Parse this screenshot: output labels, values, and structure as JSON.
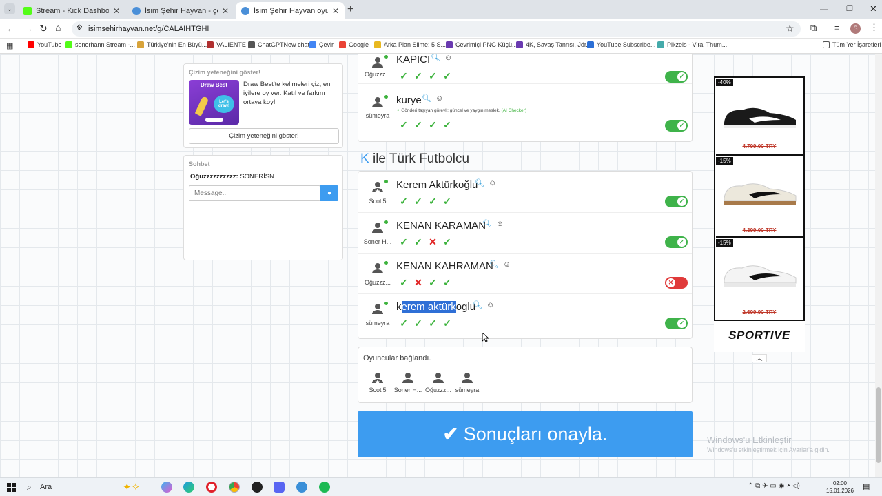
{
  "browser": {
    "tabs": [
      {
        "title": "Stream - Kick Dashboard",
        "active": false
      },
      {
        "title": "İsim Şehir Hayvan - çevrimiçi oyna",
        "active": false
      },
      {
        "title": "İsim Şehir Hayvan oyununa katıl",
        "active": true
      }
    ],
    "url": "isimsehirhayvan.net/g/CALAIHTGHI",
    "bookmarks": [
      "YouTube",
      "sonerhann Stream -...",
      "Türkiye'nin En Büyü...",
      "VALIENTE",
      "ChatGPTNew chat",
      "Çevir",
      "Google",
      "Arka Plan Silme: 5 S...",
      "Çevrimiçi PNG Küçü...",
      "4K, Savaş Tanrısı, Jör...",
      "YouTube Subscribe...",
      "Pikzels - Viral Thum..."
    ],
    "all_bookmarks": "Tüm Yer İşaretleri",
    "profile_initial": "S"
  },
  "sidebar": {
    "draw": {
      "heading": "Çizim yeteneğini göster!",
      "banner_title": "Draw Best",
      "banner_sub": "Let's draw!",
      "description": "Draw Best'te kelimeleri çiz, en iyilere oy ver. Katıl ve farkını ortaya koy!",
      "button": "Çizim yeteneğini göster!"
    },
    "chat": {
      "heading": "Sohbet",
      "author": "Oğuzzzzzzzzzz:",
      "message": "SONERİSN",
      "placeholder": "Message..."
    }
  },
  "previous_category": {
    "rows": [
      {
        "user": "Oğuzzz...",
        "word": "KAPICI",
        "votes": [
          "ok",
          "ok",
          "ok",
          "ok"
        ],
        "accepted": true
      },
      {
        "user": "sümeyra",
        "word": "kurye",
        "note": "Gönderi taşıyan görevli; güncel ve yaygın meslek.",
        "note_tag": "(AI Checker)",
        "votes": [
          "ok",
          "ok",
          "ok",
          "ok"
        ],
        "accepted": true
      }
    ]
  },
  "category": {
    "letter": "K",
    "title": "ile Türk Futbolcu",
    "rows": [
      {
        "user": "Scoti5",
        "word": "Kerem Aktürkoğlu",
        "votes": [
          "ok",
          "ok",
          "ok",
          "ok"
        ],
        "accepted": true
      },
      {
        "user": "Soner H...",
        "word": "KENAN KARAMAN",
        "votes": [
          "ok",
          "ok",
          "no",
          "ok"
        ],
        "accepted": true
      },
      {
        "user": "Oğuzzz...",
        "word": "KENAN KAHRAMAN",
        "votes": [
          "ok",
          "no",
          "ok",
          "ok"
        ],
        "accepted": false
      },
      {
        "user": "sümeyra",
        "word_pre": "k",
        "word_sel": "erem aktürk",
        "word_post": "oglu",
        "votes": [
          "ok",
          "ok",
          "ok",
          "ok"
        ],
        "accepted": true
      }
    ]
  },
  "players": {
    "heading": "Oyuncular bağlandı.",
    "list": [
      "Scoti5",
      "Soner H...",
      "Oğuzzz...",
      "sümeyra"
    ]
  },
  "confirm_button": "Sonuçları onayla.",
  "ad": {
    "items": [
      {
        "discount": "-40%",
        "price": "4.799,00 TRY",
        "shoe": "black"
      },
      {
        "discount": "-15%",
        "price": "4.399,00 TRY",
        "shoe": "cream"
      },
      {
        "discount": "-15%",
        "price": "2.699,90 TRY",
        "shoe": "white"
      }
    ],
    "brand": "SPORTIVE"
  },
  "watermark": {
    "title": "Windows'u Etkinleştir",
    "sub": "Windows'u etkinleştirmek için Ayarlar'a gidin."
  },
  "taskbar": {
    "search": "Ara",
    "time": "02:00",
    "date": "15.01.2026"
  },
  "colors": {
    "accent": "#3d9cf0",
    "ok": "#3db33d",
    "no": "#e02020"
  }
}
